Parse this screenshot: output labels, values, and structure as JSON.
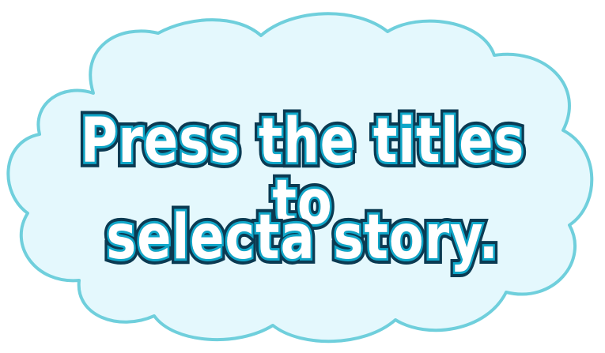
{
  "cloud": {
    "fill": "#e4f8fd",
    "outline": "#6fcfdc"
  },
  "text": {
    "fill": "#ffffff",
    "inner_outline": "#0fa7c9",
    "outer_outline": "#0b3a52"
  },
  "message": {
    "line1": "Press the titles to",
    "line2": "selecta story."
  }
}
